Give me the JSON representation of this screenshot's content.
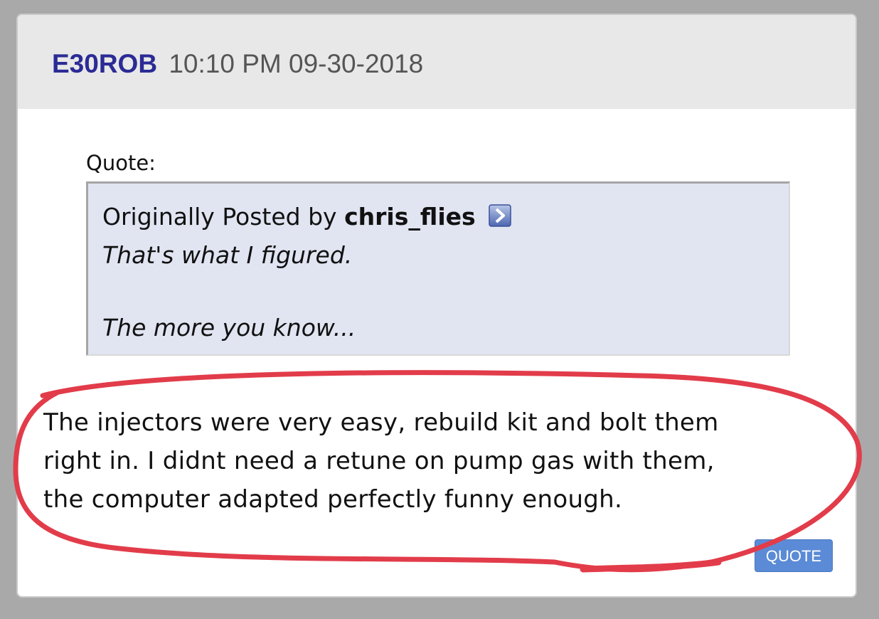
{
  "post": {
    "username": "E30ROB",
    "timestamp": "10:10 PM 09-30-2018",
    "quote_label": "Quote:",
    "quote": {
      "attribution_prefix": "Originally Posted by",
      "author": "chris_flies",
      "view_post_icon": "view-post-arrow-icon",
      "lines": [
        "That's what I figured.",
        "The more you know..."
      ]
    },
    "body_lines": [
      "The injectors were very easy, rebuild kit and bolt them",
      "right in. I didnt need a retune on pump gas with them,",
      "the computer adapted perfectly funny enough."
    ],
    "quote_button_label": "QUOTE"
  },
  "colors": {
    "username": "#2b2b96",
    "header_bg": "#e8e8e8",
    "quote_bg": "#e1e4f1",
    "button_bg": "#5b8bd6",
    "annotation": "#e23c4a"
  }
}
